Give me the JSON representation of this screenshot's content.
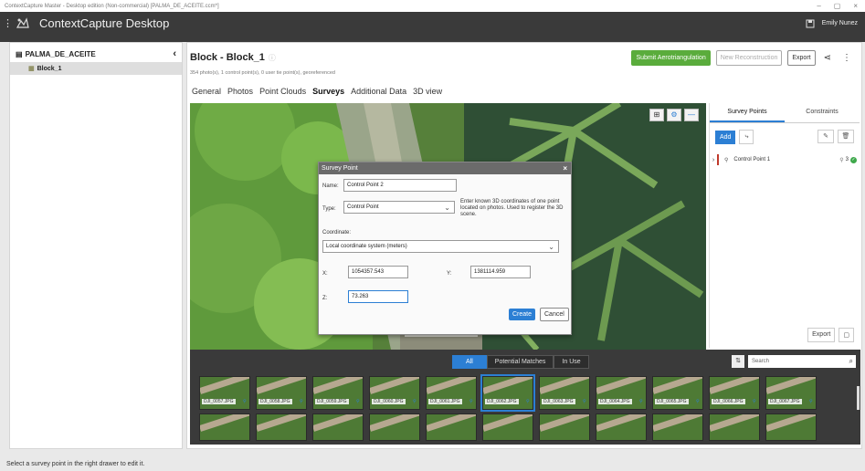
{
  "os": {
    "window_title": "ContextCapture Master - Desktop edition (Non-commercial) [PALMA_DE_ACEITE.ccm*]",
    "minimize": "–",
    "maximize": "▢",
    "close": "×"
  },
  "app": {
    "title": "ContextCapture Desktop",
    "user": "Emily Nunez"
  },
  "sidebar": {
    "project": "PALMA_DE_ACEITE",
    "collapse": "‹",
    "block": "Block_1"
  },
  "block": {
    "title": "Block - Block_1",
    "info": "ⓘ",
    "subtitle": "354 photo(s), 1 control point(s), 0 user tie point(s), georeferenced",
    "submit": "Submit Aerotriangulation",
    "new_recon": "New Reconstruction",
    "export": "Export",
    "share_icon": "⋖",
    "more_icon": "⋮"
  },
  "tabs": [
    {
      "label": "General",
      "active": false
    },
    {
      "label": "Photos",
      "active": false
    },
    {
      "label": "Point Clouds",
      "active": false
    },
    {
      "label": "Surveys",
      "active": true
    },
    {
      "label": "Additional Data",
      "active": false
    },
    {
      "label": "3D view",
      "active": false
    }
  ],
  "dialog": {
    "title": "Survey Point",
    "close": "×",
    "name_label": "Name:",
    "name_value": "Control Point 2",
    "type_label": "Type:",
    "type_value": "Control Point",
    "help": "Enter known 3D coordinates of one point located on photos. Used to register the 3D scene.",
    "coord_label": "Coordinate:",
    "coord_value": "Local coordinate system (meters)",
    "x_label": "X:",
    "x_value": "1054357.543",
    "y_label": "Y:",
    "y_value": "1381114.959",
    "z_label": "Z:",
    "z_value": "73.263",
    "create": "Create",
    "cancel": "Cancel"
  },
  "right_panel": {
    "tab_survey": "Survey Points",
    "tab_constraints": "Constraints",
    "add": "Add",
    "point_name": "Control Point 1",
    "point_count": "3",
    "export": "Export"
  },
  "thumbs": {
    "filters": [
      "All",
      "Potential Matches",
      "In Use"
    ],
    "search_placeholder": "Search",
    "row1": [
      "DJI_0057.JPG",
      "DJI_0058.JPG",
      "DJI_0059.JPG",
      "DJI_0060.JPG",
      "DJI_0061.JPG",
      "DJI_0062.JPG",
      "DJI_0063.JPG",
      "DJI_0064.JPG",
      "DJI_0065.JPG",
      "DJI_0066.JPG",
      "DJI_0067.JPG"
    ],
    "selected_index": 5,
    "row2_count": 11
  },
  "status": "Select a survey point in the right drawer to edit it.",
  "colors": {
    "accent": "#2c7fd4",
    "green": "#5aac3c",
    "header": "#3a3a3a"
  }
}
